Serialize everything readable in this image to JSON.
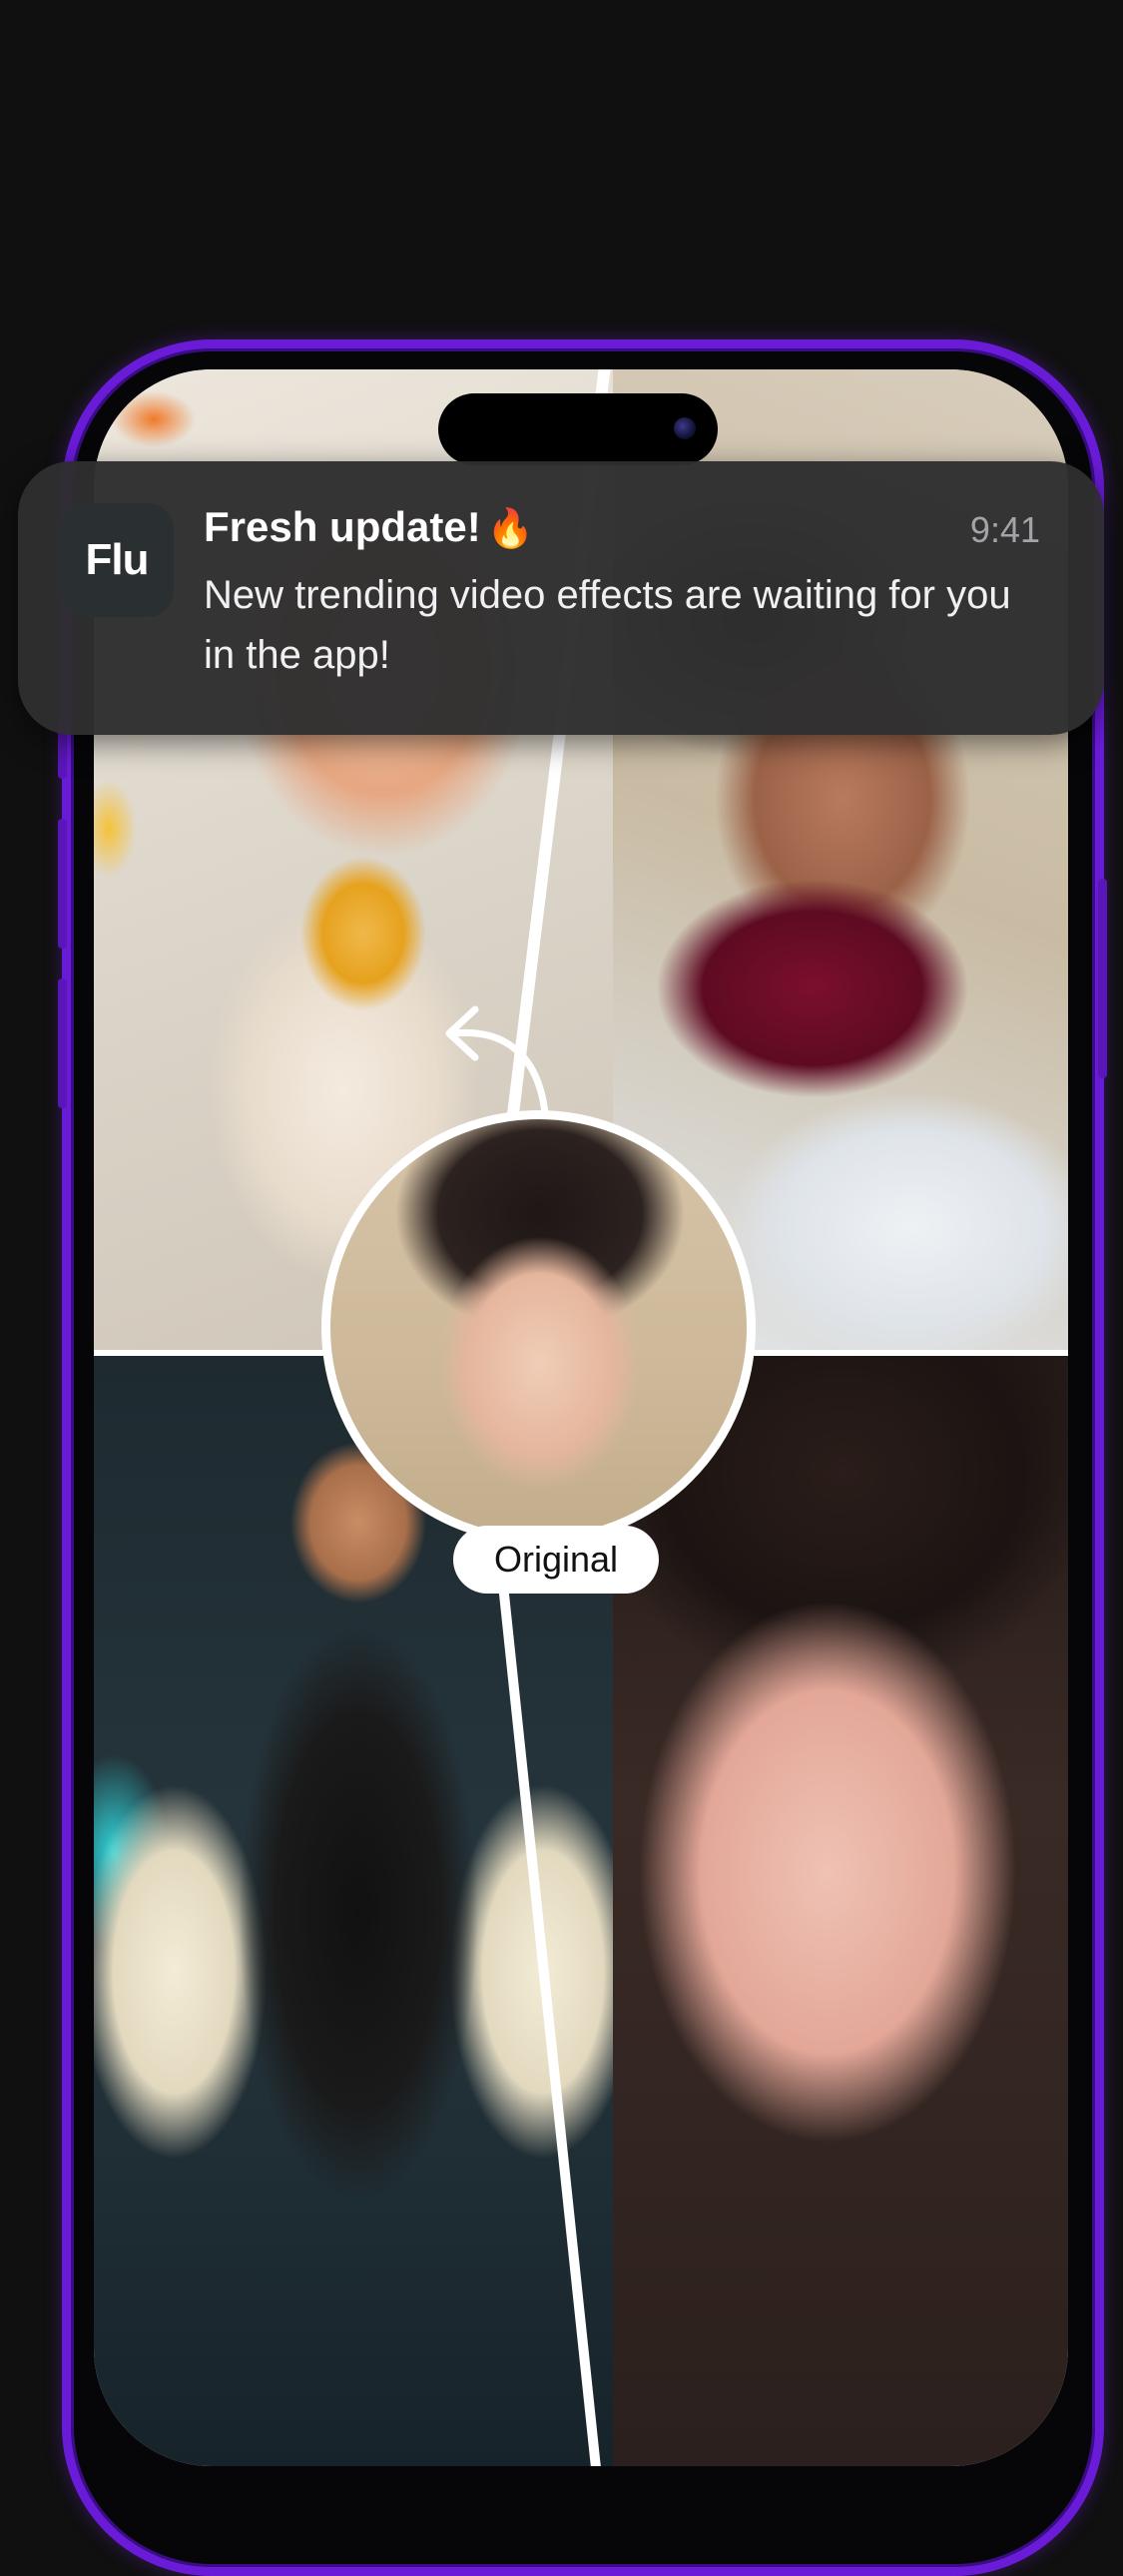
{
  "notification": {
    "app_icon_label": "Flu",
    "title": "Fresh update!",
    "title_emoji": "🔥",
    "time": "9:41",
    "body": "New trending video effects are waiting for you in the app!"
  },
  "collage": {
    "original_label": "Original",
    "photos": [
      "flowers-portrait",
      "velvet-dress-portrait",
      "latex-outfit-portrait",
      "closeup-portrait"
    ]
  },
  "colors": {
    "frame_accent": "#6a1bd8",
    "background": "#101010",
    "notification_bg": "#2e2e30"
  }
}
